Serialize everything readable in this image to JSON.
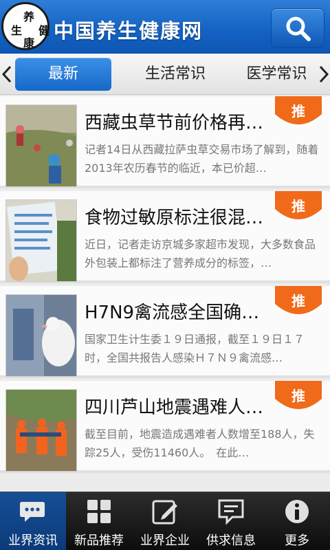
{
  "header": {
    "logo_chars": [
      "养",
      "生",
      "健",
      "康"
    ],
    "site_title": "中国养生健康网"
  },
  "tabs": {
    "items": [
      {
        "label": "最新",
        "active": true
      },
      {
        "label": "生活常识",
        "active": false
      },
      {
        "label": "医学常识",
        "active": false
      }
    ]
  },
  "news": {
    "badge_label": "推",
    "items": [
      {
        "headline": "西藏虫草节前价格再…",
        "summary": "记者14日从西藏拉萨虫草交易市场了解到，随着2013年农历春节的临近，本已价超…"
      },
      {
        "headline": "食物过敏原标注很混…",
        "summary": "近日，记者走访京城多家超市发现，大多数食品外包装上都标注了营养成分的标签，…"
      },
      {
        "headline": "H7N9禽流感全国确…",
        "summary": "国家卫生计生委１９日通报，截至１９日１７时，全国共报告人感染Ｈ７Ｎ９禽流感…"
      },
      {
        "headline": "四川芦山地震遇难人…",
        "summary": "截至目前，地震造成遇难者人数增至188人，失踪25人，受伤11460人。　在此…"
      }
    ]
  },
  "bottom_nav": {
    "items": [
      {
        "label": "业界资讯",
        "icon": "chat-bubble-icon",
        "active": true
      },
      {
        "label": "新品推荐",
        "icon": "grid-icon",
        "active": false
      },
      {
        "label": "业界企业",
        "icon": "edit-icon",
        "active": false
      },
      {
        "label": "供求信息",
        "icon": "message-icon",
        "active": false
      },
      {
        "label": "更多",
        "icon": "info-icon",
        "active": false
      }
    ]
  },
  "colors": {
    "header_blue": "#1463c4",
    "badge_orange": "#f06a1a",
    "active_nav": "#174f97"
  }
}
